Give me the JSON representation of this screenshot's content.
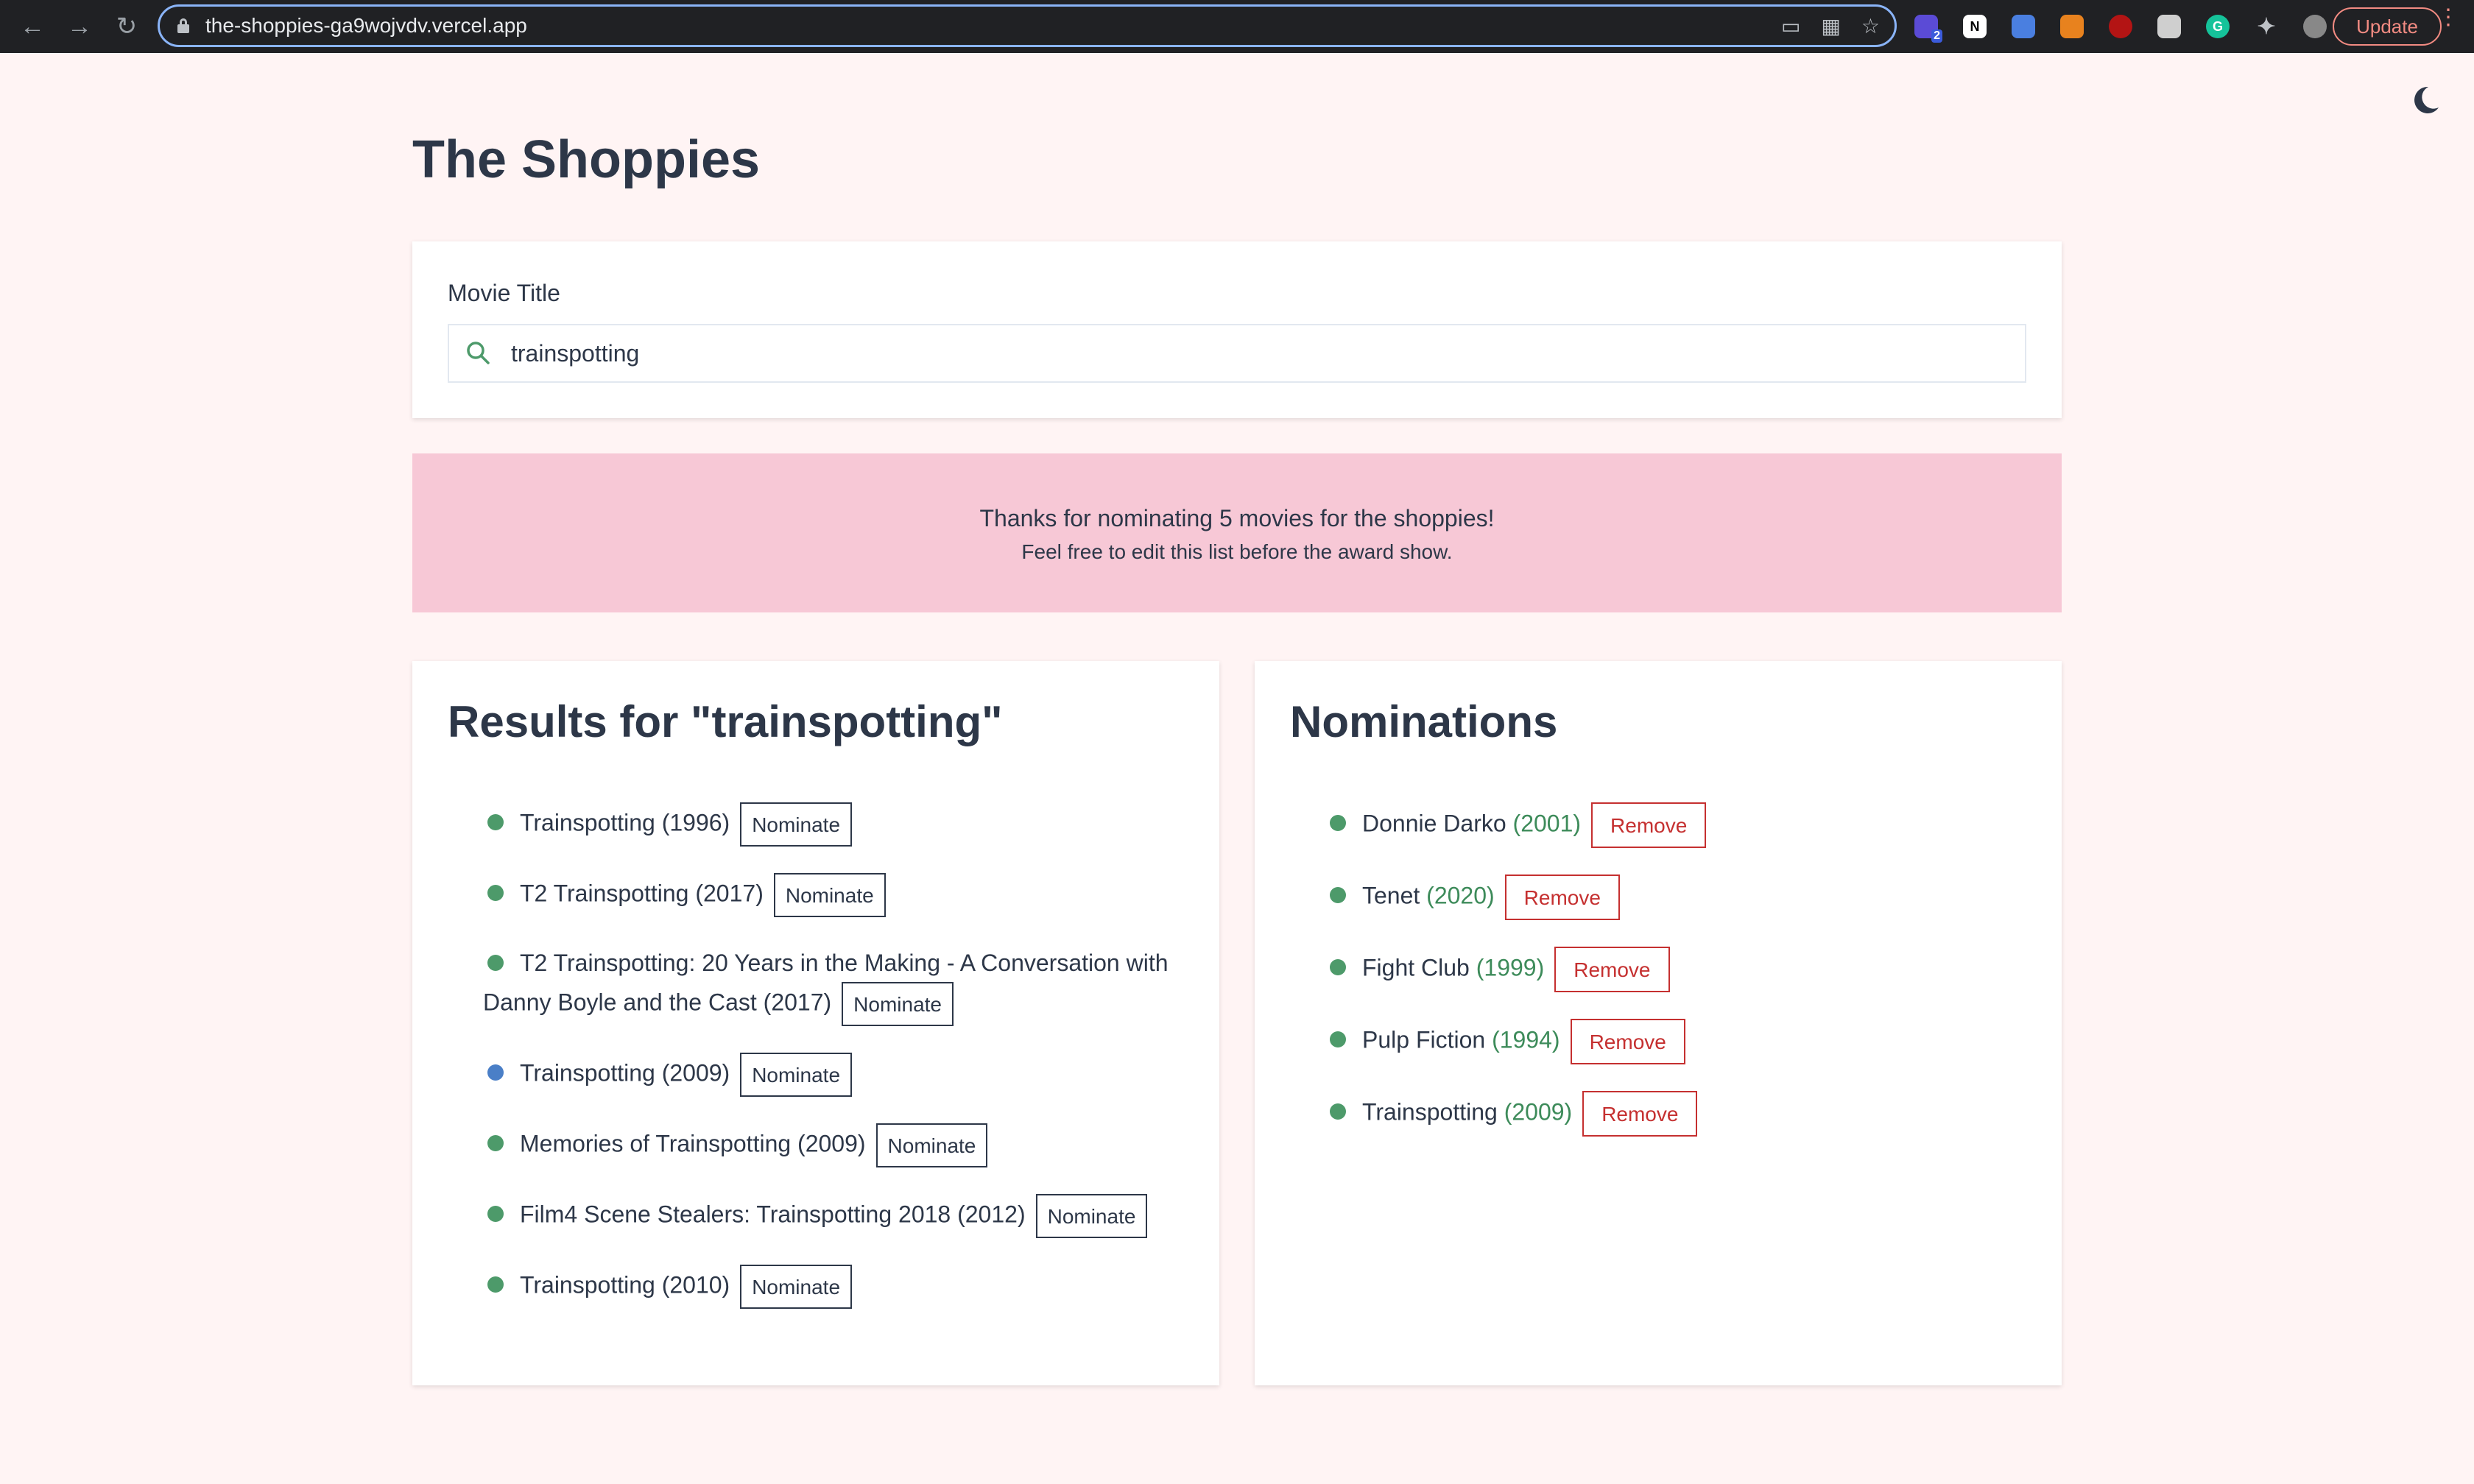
{
  "browser": {
    "url": "the-shoppies-ga9wojvdv.vercel.app",
    "update_label": "Update",
    "extension_badge": "2"
  },
  "page": {
    "title": "The Shoppies"
  },
  "search": {
    "label": "Movie Title",
    "value": "trainspotting"
  },
  "banner": {
    "message": "Thanks for nominating 5 movies for the shoppies!",
    "sub_message": "Feel free to edit this list before the award show."
  },
  "results": {
    "heading": "Results for \"trainspotting\"",
    "button_label": "Nominate",
    "items": [
      {
        "label": "Trainspotting (1996)",
        "dot_color": "#4d9a6a"
      },
      {
        "label": "T2 Trainspotting (2017)",
        "dot_color": "#4d9a6a"
      },
      {
        "label": "T2 Trainspotting: 20 Years in the Making - A Conversation with Danny Boyle and the Cast (2017)",
        "dot_color": "#4d9a6a"
      },
      {
        "label": "Trainspotting (2009)",
        "dot_color": "#4a7fc7"
      },
      {
        "label": "Memories of Trainspotting (2009)",
        "dot_color": "#4d9a6a"
      },
      {
        "label": "Film4 Scene Stealers: Trainspotting 2018 (2012)",
        "dot_color": "#4d9a6a"
      },
      {
        "label": "Trainspotting (2010)",
        "dot_color": "#4d9a6a"
      }
    ]
  },
  "nominations": {
    "heading": "Nominations",
    "button_label": "Remove",
    "items": [
      {
        "title": "Donnie Darko",
        "year": "(2001)"
      },
      {
        "title": "Tenet",
        "year": "(2020)"
      },
      {
        "title": "Fight Club",
        "year": "(1999)"
      },
      {
        "title": "Pulp Fiction",
        "year": "(1994)"
      },
      {
        "title": "Trainspotting",
        "year": "(2009)"
      }
    ]
  }
}
